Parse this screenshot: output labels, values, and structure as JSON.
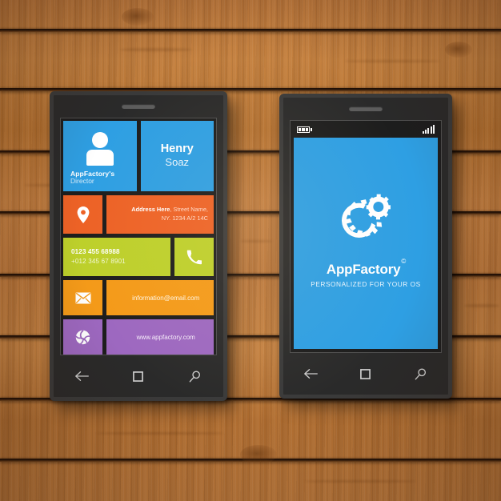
{
  "scene": {
    "background": "wooden-planks",
    "wood_color": "#b8753a"
  },
  "colors": {
    "blue": "#2e9fe3",
    "orange": "#ed6226",
    "lime": "#bdd02b",
    "amber": "#f49a19",
    "purple": "#9d68c0",
    "phone_body": "#2a2a2a",
    "phone_frame": "#3a3a3a"
  },
  "front_card": {
    "profile_tile": {
      "icon": "person-avatar-icon",
      "company": "AppFactory's",
      "role": "Director"
    },
    "name_tile": {
      "first_name": "Henry",
      "last_name": "Soaz"
    },
    "address_tile": {
      "icon": "map-pin-icon",
      "label": "Address Here",
      "line1": ", Street Name,",
      "line2": "NY. 1234 A/2 14C"
    },
    "phone_tile": {
      "icon": "telephone-icon",
      "primary": "0123 455 68988",
      "secondary": "+012 345 67 8901"
    },
    "email_tile": {
      "icon": "envelope-icon",
      "email": "information@email.com"
    },
    "web_tile": {
      "icon": "globe-ball-icon",
      "website": "www.appfactory.com"
    }
  },
  "back_card": {
    "statusbar": {
      "battery_icon": "battery-icon",
      "battery_cells": 3,
      "signal_icon": "signal-bars-icon",
      "signal_bars": 5
    },
    "logo_icon": "double-gear-icon",
    "brand_name": "AppFactory",
    "brand_mark": "©",
    "tagline": "PERSONALIZED FOR YOUR OS"
  },
  "navbar": {
    "back_icon": "back-arrow-icon",
    "home_icon": "square-home-icon",
    "search_icon": "search-magnifier-icon"
  }
}
